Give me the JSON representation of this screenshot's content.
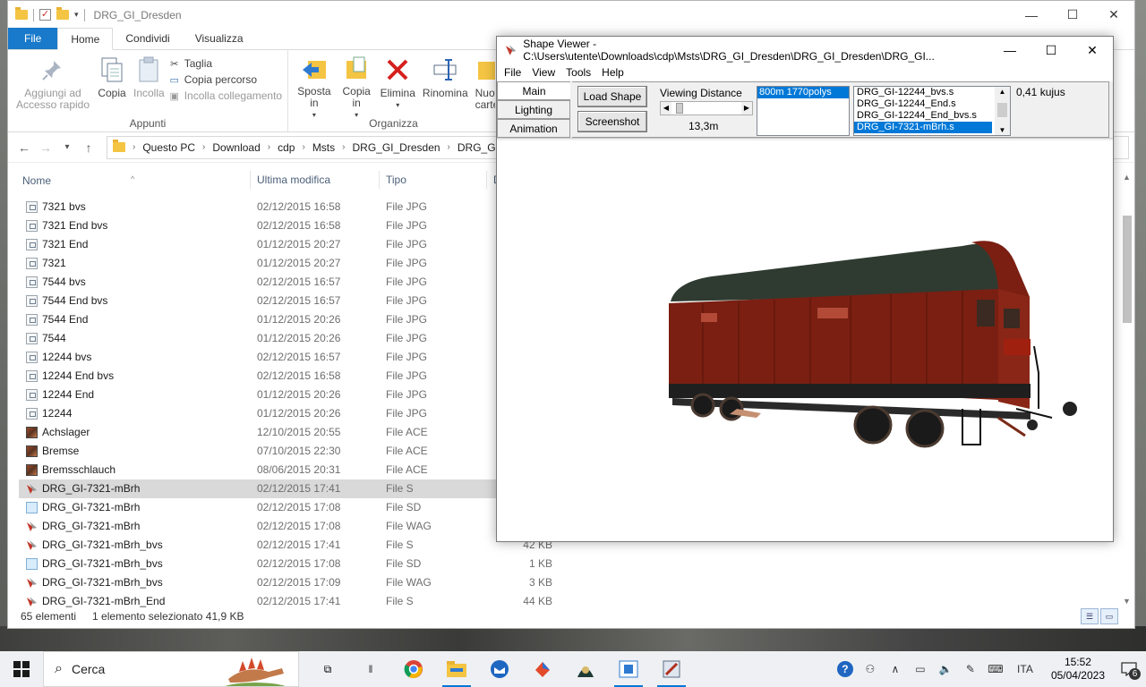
{
  "explorer": {
    "title": "DRG_GI_Dresden",
    "ribbon_tabs": [
      "File",
      "Home",
      "Condividi",
      "Visualizza"
    ],
    "clipboard": {
      "pin_label": "Aggiungi ad Accesso rapido",
      "copy_label": "Copia",
      "paste_label": "Incolla",
      "cut_label": "Taglia",
      "copy_path_label": "Copia percorso",
      "paste_shortcut_label": "Incolla collegamento",
      "group_label": "Appunti"
    },
    "organize": {
      "move_label": "Sposta in",
      "copy_to_label": "Copia in",
      "delete_label": "Elimina",
      "rename_label": "Rinomina",
      "new_folder_label": "Nuov cartel",
      "group_label": "Organizza"
    },
    "breadcrumb": [
      "Questo PC",
      "Download",
      "cdp",
      "Msts",
      "DRG_GI_Dresden",
      "DRG_GI_"
    ],
    "columns": {
      "name": "Nome",
      "modified": "Ultima modifica",
      "type": "Tipo",
      "size": "D"
    },
    "files": [
      {
        "name": "7321 bvs",
        "date": "02/12/2015 16:58",
        "type": "File JPG",
        "size": "",
        "icon": "jpg"
      },
      {
        "name": "7321 End bvs",
        "date": "02/12/2015 16:58",
        "type": "File JPG",
        "size": "",
        "icon": "jpg"
      },
      {
        "name": "7321 End",
        "date": "01/12/2015 20:27",
        "type": "File JPG",
        "size": "",
        "icon": "jpg"
      },
      {
        "name": "7321",
        "date": "01/12/2015 20:27",
        "type": "File JPG",
        "size": "",
        "icon": "jpg"
      },
      {
        "name": "7544 bvs",
        "date": "02/12/2015 16:57",
        "type": "File JPG",
        "size": "",
        "icon": "jpg"
      },
      {
        "name": "7544 End bvs",
        "date": "02/12/2015 16:57",
        "type": "File JPG",
        "size": "",
        "icon": "jpg"
      },
      {
        "name": "7544 End",
        "date": "01/12/2015 20:26",
        "type": "File JPG",
        "size": "",
        "icon": "jpg"
      },
      {
        "name": "7544",
        "date": "01/12/2015 20:26",
        "type": "File JPG",
        "size": "",
        "icon": "jpg"
      },
      {
        "name": "12244 bvs",
        "date": "02/12/2015 16:57",
        "type": "File JPG",
        "size": "",
        "icon": "jpg"
      },
      {
        "name": "12244 End bvs",
        "date": "02/12/2015 16:58",
        "type": "File JPG",
        "size": "",
        "icon": "jpg"
      },
      {
        "name": "12244 End",
        "date": "01/12/2015 20:26",
        "type": "File JPG",
        "size": "",
        "icon": "jpg"
      },
      {
        "name": "12244",
        "date": "01/12/2015 20:26",
        "type": "File JPG",
        "size": "",
        "icon": "jpg"
      },
      {
        "name": "Achslager",
        "date": "12/10/2015 20:55",
        "type": "File ACE",
        "size": "",
        "icon": "ace"
      },
      {
        "name": "Bremse",
        "date": "07/10/2015 22:30",
        "type": "File ACE",
        "size": "",
        "icon": "ace"
      },
      {
        "name": "Bremsschlauch",
        "date": "08/06/2015 20:31",
        "type": "File ACE",
        "size": "",
        "icon": "ace"
      },
      {
        "name": "DRG_GI-7321-mBrh",
        "date": "02/12/2015 17:41",
        "type": "File S",
        "size": "",
        "icon": "s",
        "selected": true
      },
      {
        "name": "DRG_GI-7321-mBrh",
        "date": "02/12/2015 17:08",
        "type": "File SD",
        "size": "",
        "icon": "sd"
      },
      {
        "name": "DRG_GI-7321-mBrh",
        "date": "02/12/2015 17:08",
        "type": "File WAG",
        "size": "",
        "icon": "s"
      },
      {
        "name": "DRG_GI-7321-mBrh_bvs",
        "date": "02/12/2015 17:41",
        "type": "File S",
        "size": "42 KB",
        "icon": "s"
      },
      {
        "name": "DRG_GI-7321-mBrh_bvs",
        "date": "02/12/2015 17:08",
        "type": "File SD",
        "size": "1 KB",
        "icon": "sd"
      },
      {
        "name": "DRG_GI-7321-mBrh_bvs",
        "date": "02/12/2015 17:09",
        "type": "File WAG",
        "size": "3 KB",
        "icon": "s"
      },
      {
        "name": "DRG_GI-7321-mBrh_End",
        "date": "02/12/2015 17:41",
        "type": "File S",
        "size": "44 KB",
        "icon": "s"
      }
    ],
    "status": {
      "count": "65 elementi",
      "selection": "1 elemento selezionato  41,9 KB"
    }
  },
  "viewer": {
    "title": "Shape Viewer - C:\\Users\\utente\\Downloads\\cdp\\Msts\\DRG_GI_Dresden\\DRG_GI_Dresden\\DRG_GI...",
    "menu": [
      "File",
      "View",
      "Tools",
      "Help"
    ],
    "tabs": [
      "Main",
      "Lighting",
      "Animation"
    ],
    "load_shape_label": "Load Shape",
    "screenshot_label": "Screenshot",
    "viewing_distance_label": "Viewing Distance",
    "viewing_distance_value": "13,3m",
    "viewing_distance_slider_fraction": 0.05,
    "lod_items": [
      "800m 1770polys"
    ],
    "shape_items": [
      "DRG_GI-12244_bvs.s",
      "DRG_GI-12244_End.s",
      "DRG_GI-12244_End_bvs.s",
      "DRG_GI-7321-mBrh.s"
    ],
    "selected_shape_index": 3,
    "kujus_label": "0,41 kujus"
  },
  "taskbar": {
    "search_label": "Cerca",
    "language": "ITA",
    "time": "15:52",
    "date": "05/04/2023",
    "notification_count": "6"
  },
  "colors": {
    "accent": "#0078d7",
    "file_tab": "#1979ca",
    "wagon_body": "#7a1f12",
    "wagon_roof": "#2f3b31"
  }
}
